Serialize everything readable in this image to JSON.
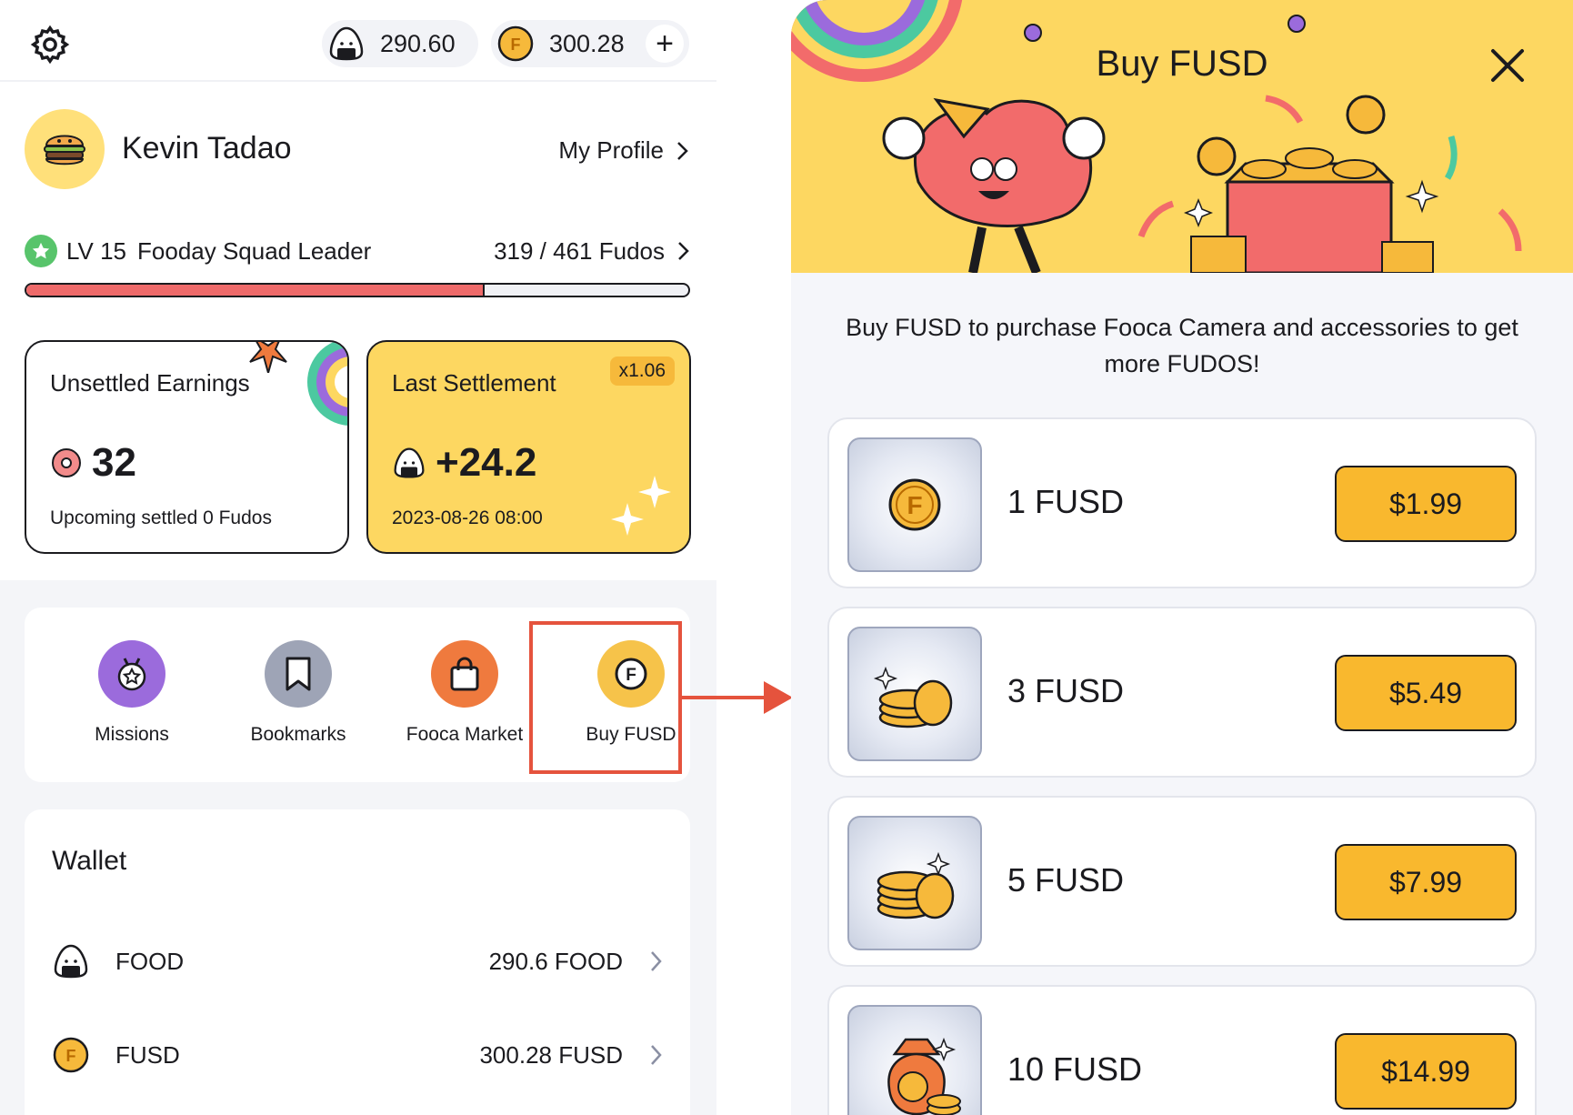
{
  "topbar": {
    "food_balance": "290.60",
    "fusd_balance": "300.28",
    "add_label": "+"
  },
  "profile": {
    "name": "Kevin Tadao",
    "my_profile_label": "My Profile"
  },
  "level": {
    "level_label": "LV 15",
    "rank_title": "Fooday Squad Leader",
    "progress_text": "319 / 461 Fudos",
    "progress_fraction": 0.692
  },
  "cards": {
    "unsettled": {
      "title": "Unsettled Earnings",
      "value": "32",
      "subtitle": "Upcoming settled 0 Fudos"
    },
    "last": {
      "title": "Last Settlement",
      "multiplier": "x1.06",
      "value": "+24.2",
      "timestamp": "2023-08-26 08:00"
    }
  },
  "shortcuts": [
    {
      "label": "Missions",
      "icon": "medal-icon",
      "color": "#9b6bdc"
    },
    {
      "label": "Bookmarks",
      "icon": "bookmark-icon",
      "color": "#9ea4b6"
    },
    {
      "label": "Fooca Market",
      "icon": "shopping-bag-icon",
      "color": "#ef7a3e"
    },
    {
      "label": "Buy FUSD",
      "icon": "fusd-coin-icon",
      "color": "#f6c34a"
    }
  ],
  "wallet": {
    "title": "Wallet",
    "rows": [
      {
        "name": "FOOD",
        "value": "290.6 FOOD"
      },
      {
        "name": "FUSD",
        "value": "300.28 FUSD"
      }
    ]
  },
  "buy_panel": {
    "title": "Buy FUSD",
    "description": "Buy FUSD to purchase Fooca Camera and accessories to get more FUDOS!",
    "items": [
      {
        "name": "1 FUSD",
        "price": "$1.99",
        "icon": "single-coin-icon"
      },
      {
        "name": "3 FUSD",
        "price": "$5.49",
        "icon": "coin-stack-icon"
      },
      {
        "name": "5 FUSD",
        "price": "$7.99",
        "icon": "coin-stack-icon"
      },
      {
        "name": "10 FUSD",
        "price": "$14.99",
        "icon": "money-bag-icon"
      }
    ]
  },
  "colors": {
    "accent_yellow": "#fdd761",
    "price_button": "#f9b82e",
    "progress_fill": "#ee6a6a",
    "highlight": "#e5533d"
  }
}
